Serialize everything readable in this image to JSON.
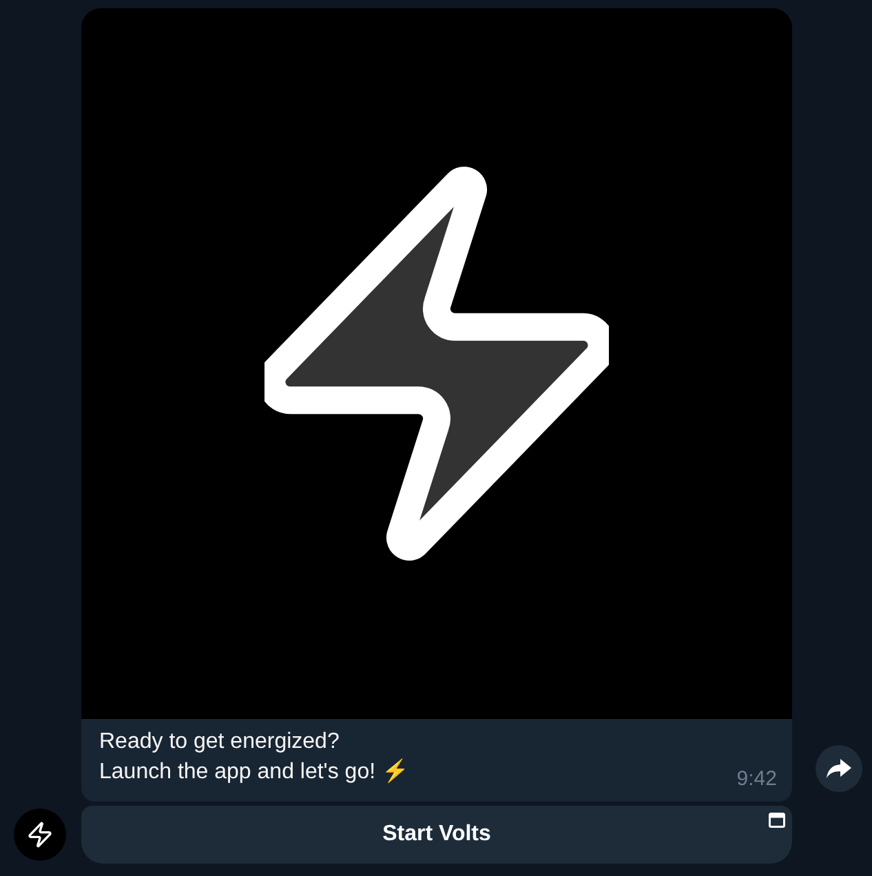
{
  "message": {
    "caption": "Ready to get energized?\nLaunch the app and let's go! ⚡",
    "time": "9:42"
  },
  "button": {
    "label": "Start Volts"
  }
}
